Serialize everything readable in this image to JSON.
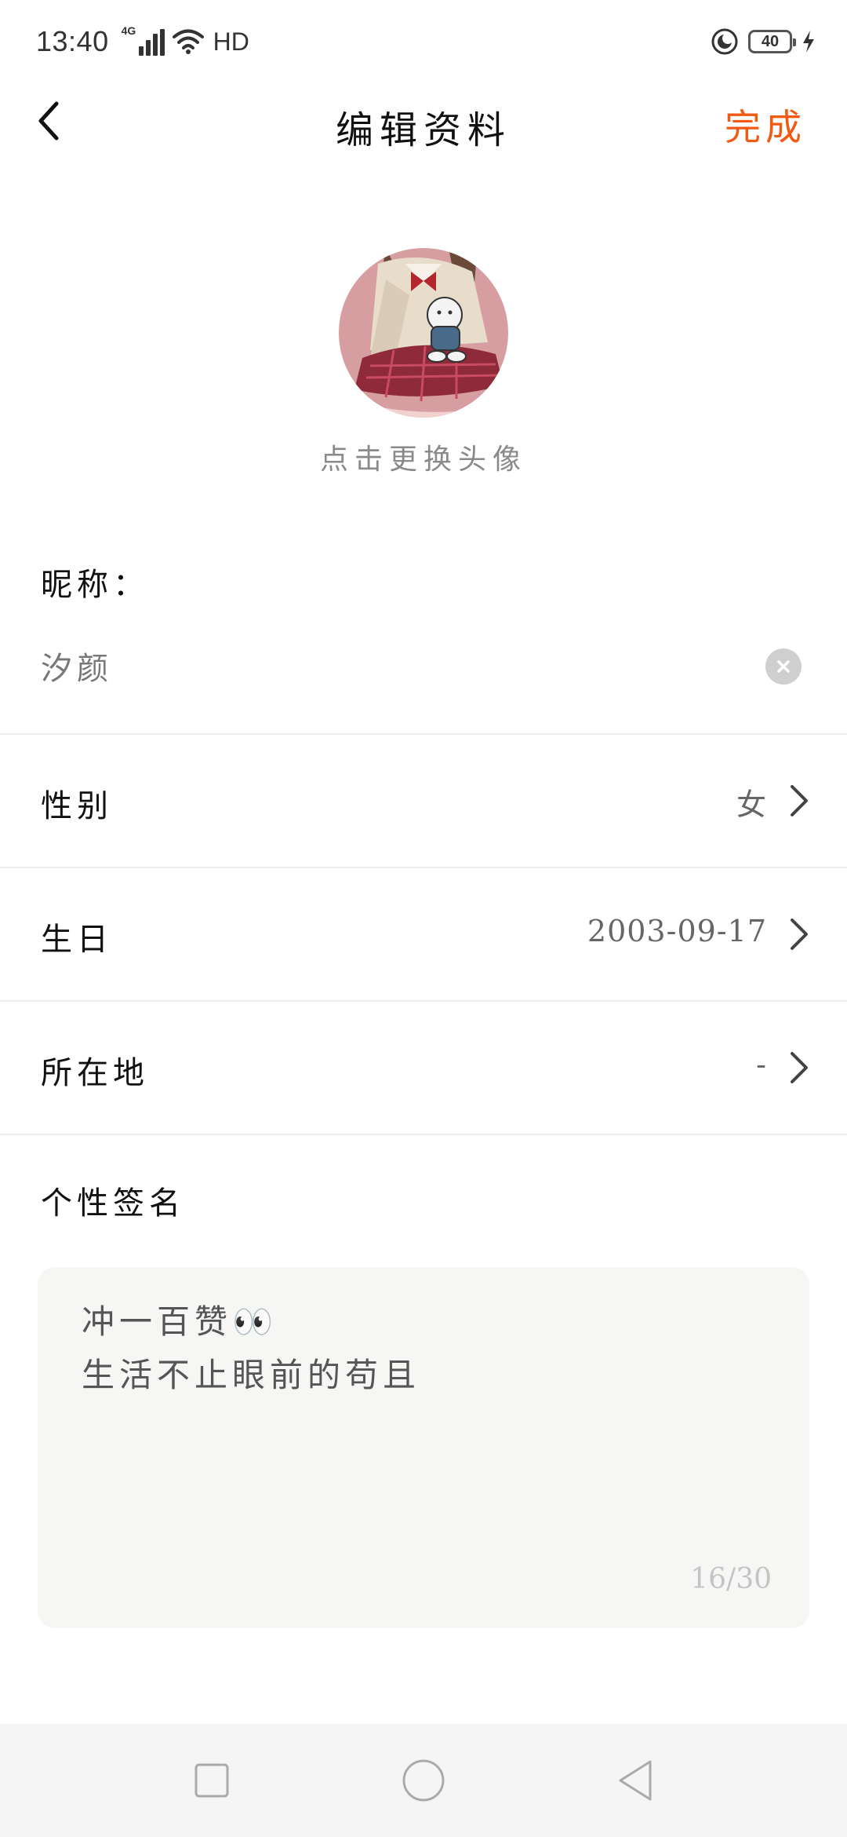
{
  "status_bar": {
    "time": "13:40",
    "network_type": "4G",
    "hd_label": "HD",
    "battery_level": "40",
    "icons": [
      "signal-icon",
      "wifi-icon",
      "do-not-disturb-icon",
      "battery-icon",
      "charging-icon"
    ]
  },
  "header": {
    "title": "编辑资料",
    "done_label": "完成",
    "accent_color": "#f05a12"
  },
  "avatar": {
    "hint": "点击更换头像"
  },
  "nickname": {
    "label": "昵称：",
    "value": "汐颜"
  },
  "gender": {
    "label": "性别",
    "value": "女"
  },
  "birthday": {
    "label": "生日",
    "value": "2003-09-17"
  },
  "location": {
    "label": "所在地",
    "value": "-"
  },
  "signature": {
    "label": "个性签名",
    "value": "冲一百赞👀\n生活不止眼前的苟且",
    "counter": "16/30"
  },
  "nav_bar": {
    "icons": [
      "recent-apps-icon",
      "home-icon",
      "back-triangle-icon"
    ]
  }
}
